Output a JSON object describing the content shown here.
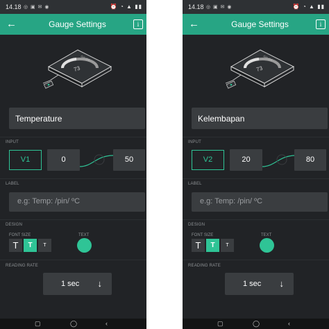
{
  "status_bar": {
    "time": "14.18",
    "notifications": "◎ ▣ ✉ ◉",
    "icons": "⏰ ◔ ▲ ▮▮"
  },
  "accent": "#2fc496",
  "screens": [
    {
      "header": {
        "title": "Gauge Settings",
        "back_icon": "←",
        "info_icon": "i"
      },
      "illustration": {
        "gauge_value": "73",
        "device_label": "GAUGE"
      },
      "name_value": "Temperature",
      "input": {
        "section": "INPUT",
        "pin": "V1",
        "min": "0",
        "max": "50"
      },
      "label": {
        "section": "LABEL",
        "placeholder": "e.g: Temp: /pin/ ºC"
      },
      "design": {
        "section": "DESIGN",
        "font_size_label": "FONT SIZE",
        "text_label": "TEXT",
        "sizes": [
          "T",
          "T",
          "T"
        ],
        "selected_size_index": 1,
        "text_color": "#2fc496"
      },
      "reading_rate": {
        "section": "READING RATE",
        "value": "1 sec",
        "arrow": "↓"
      },
      "nav": {
        "square": "▢",
        "home": "◯",
        "back": "‹"
      }
    },
    {
      "header": {
        "title": "Gauge Settings",
        "back_icon": "←",
        "info_icon": "i"
      },
      "illustration": {
        "gauge_value": "73",
        "device_label": "GAUGE"
      },
      "name_value": "Kelembapan",
      "input": {
        "section": "INPUT",
        "pin": "V2",
        "min": "20",
        "max": "80"
      },
      "label": {
        "section": "LABEL",
        "placeholder": "e.g: Temp: /pin/ ºC"
      },
      "design": {
        "section": "DESIGN",
        "font_size_label": "FONT SIZE",
        "text_label": "TEXT",
        "sizes": [
          "T",
          "T",
          "T"
        ],
        "selected_size_index": 1,
        "text_color": "#2fc496"
      },
      "reading_rate": {
        "section": "READING RATE",
        "value": "1 sec",
        "arrow": "↓"
      },
      "nav": {
        "square": "▢",
        "home": "◯",
        "back": "‹"
      }
    }
  ]
}
